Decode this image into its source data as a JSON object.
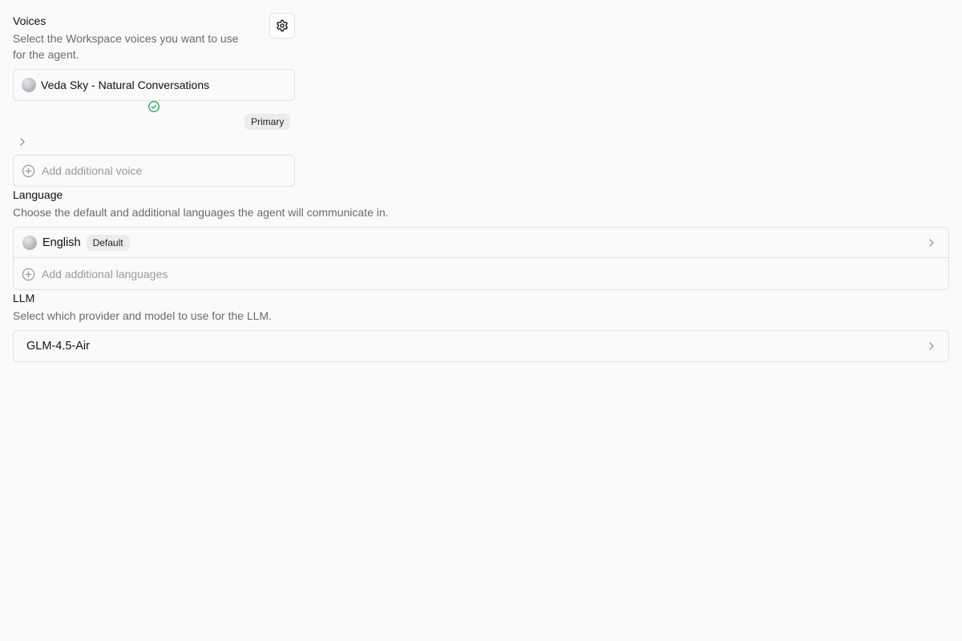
{
  "voices": {
    "title": "Voices",
    "description_line1": "Select the Workspace voices you want to use",
    "description_line2": "for the agent.",
    "settings_icon": "gear-icon",
    "selected_voice": "Veda Sky - Natural Conversations",
    "status_icon": "check-circle-icon",
    "status_color": "#22a35a",
    "primary_badge": "Primary",
    "add_placeholder": "Add additional voice"
  },
  "language": {
    "title": "Language",
    "description": "Choose the default and additional languages the agent will communicate in.",
    "selected": "English",
    "default_badge": "Default",
    "add_placeholder": "Add additional languages"
  },
  "llm": {
    "title": "LLM",
    "description": "Select which provider and model to use for the LLM.",
    "model": "GLM-4.5-Air"
  }
}
